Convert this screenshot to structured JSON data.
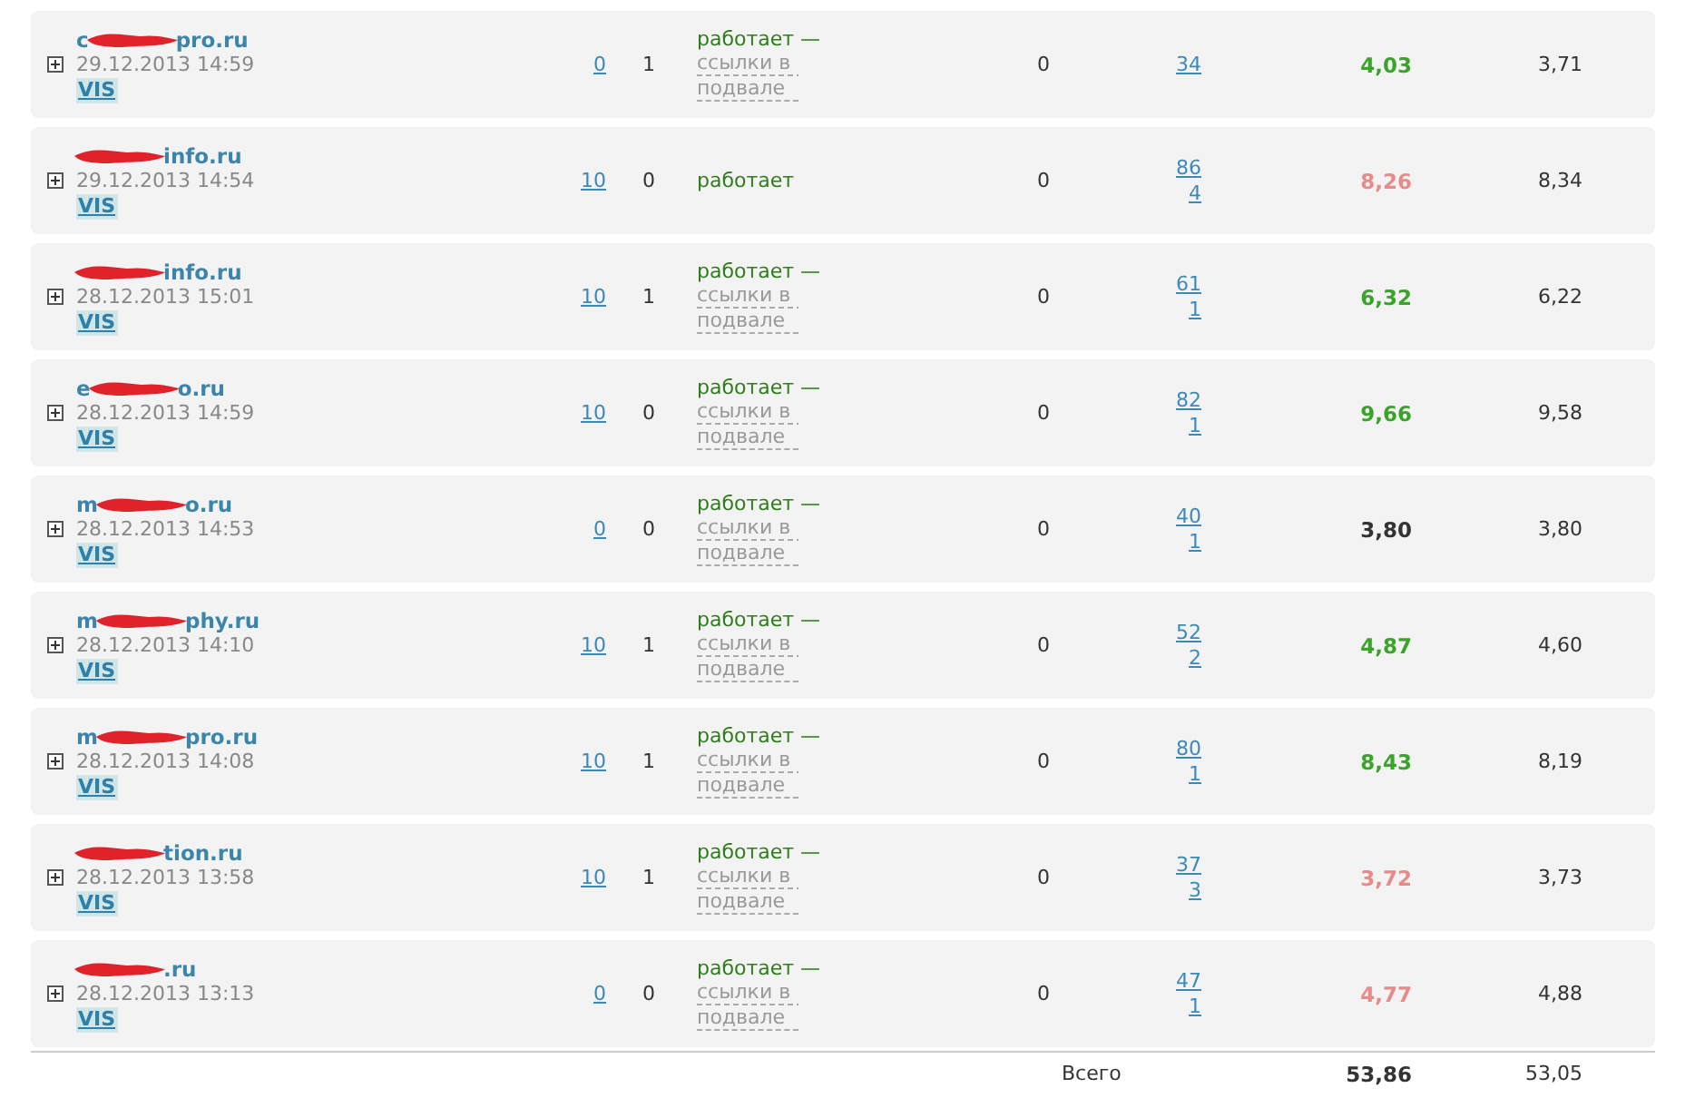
{
  "rows": [
    {
      "domain_start": "c",
      "domain_end": "pro.ru",
      "date": "29.12.2013 14:59",
      "badge": "VIS",
      "col_link": "0",
      "col_num": "1",
      "status": "работает —",
      "status_note": "ссылки в подвале",
      "col_zero": "0",
      "links": [
        "34"
      ],
      "score": "4,03",
      "color": "#3aa32a",
      "score_prev": "3,71"
    },
    {
      "domain_start": "",
      "domain_end": "info.ru",
      "date": "29.12.2013 14:54",
      "badge": "VIS",
      "col_link": "10",
      "col_num": "0",
      "status": "работает",
      "col_zero": "0",
      "links": [
        "86",
        "4"
      ],
      "score": "8,26",
      "color": "#e78a8a",
      "score_prev": "8,34"
    },
    {
      "domain_start": "",
      "domain_end": "info.ru",
      "date": "28.12.2013 15:01",
      "badge": "VIS",
      "col_link": "10",
      "col_num": "1",
      "status": "работает —",
      "status_note": "ссылки в подвале",
      "col_zero": "0",
      "links": [
        "61",
        "1"
      ],
      "score": "6,32",
      "color": "#3aa32a",
      "score_prev": "6,22"
    },
    {
      "domain_start": "e",
      "domain_end": "o.ru",
      "date": "28.12.2013 14:59",
      "badge": "VIS",
      "col_link": "10",
      "col_num": "0",
      "status": "работает —",
      "status_note": "ссылки в подвале",
      "col_zero": "0",
      "links": [
        "82",
        "1"
      ],
      "score": "9,66",
      "color": "#3aa32a",
      "score_prev": "9,58"
    },
    {
      "domain_start": "m",
      "domain_end": "o.ru",
      "date": "28.12.2013 14:53",
      "badge": "VIS",
      "col_link": "0",
      "col_num": "0",
      "status": "работает —",
      "status_note": "ссылки в подвале",
      "col_zero": "0",
      "links": [
        "40",
        "1"
      ],
      "score": "3,80",
      "color": "#333333",
      "score_prev": "3,80"
    },
    {
      "domain_start": "m",
      "domain_end": "phy.ru",
      "date": "28.12.2013 14:10",
      "badge": "VIS",
      "col_link": "10",
      "col_num": "1",
      "status": "работает —",
      "status_note": "ссылки в подвале",
      "col_zero": "0",
      "links": [
        "52",
        "2"
      ],
      "score": "4,87",
      "color": "#3aa32a",
      "score_prev": "4,60"
    },
    {
      "domain_start": "m",
      "domain_end": "pro.ru",
      "date": "28.12.2013 14:08",
      "badge": "VIS",
      "col_link": "10",
      "col_num": "1",
      "status": "работает —",
      "status_note": "ссылки в подвале",
      "col_zero": "0",
      "links": [
        "80",
        "1"
      ],
      "score": "8,43",
      "color": "#3aa32a",
      "score_prev": "8,19"
    },
    {
      "domain_start": "",
      "domain_end": "tion.ru",
      "date": "28.12.2013 13:58",
      "badge": "VIS",
      "col_link": "10",
      "col_num": "1",
      "status": "работает —",
      "status_note": "ссылки в подвале",
      "col_zero": "0",
      "links": [
        "37",
        "3"
      ],
      "score": "3,72",
      "color": "#e78a8a",
      "score_prev": "3,73"
    },
    {
      "domain_start": "",
      "domain_end": ".ru",
      "date": "28.12.2013 13:13",
      "badge": "VIS",
      "col_link": "0",
      "col_num": "0",
      "status": "работает —",
      "status_note": "ссылки в подвале",
      "col_zero": "0",
      "links": [
        "47",
        "1"
      ],
      "score": "4,77",
      "color": "#e78a8a",
      "score_prev": "4,88"
    }
  ],
  "total": {
    "label": "Всего",
    "score": "53,86",
    "score_prev": "53,05"
  }
}
